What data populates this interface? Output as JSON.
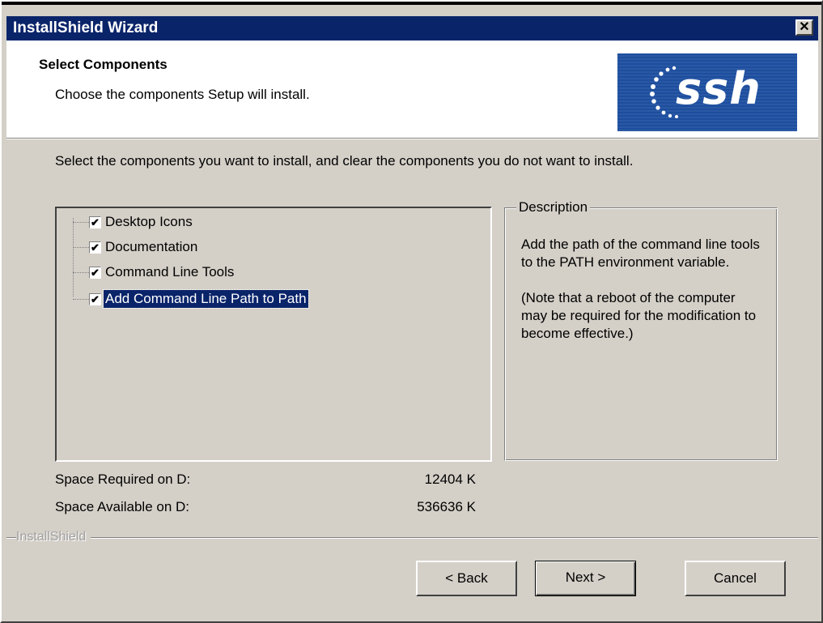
{
  "window": {
    "title": "InstallShield Wizard",
    "close_glyph": "✕"
  },
  "header": {
    "title": "Select Components",
    "subtitle": "Choose the components Setup will install.",
    "logo_text": "ssh"
  },
  "instructions": "Select the components you want to install, and clear the components you do not want to install.",
  "components": [
    {
      "label": "Desktop Icons",
      "checked": true,
      "selected": false
    },
    {
      "label": "Documentation",
      "checked": true,
      "selected": false
    },
    {
      "label": "Command Line Tools",
      "checked": true,
      "selected": false
    },
    {
      "label": "Add Command Line Path to Path",
      "checked": true,
      "selected": true
    }
  ],
  "check_glyph": "✔",
  "description": {
    "legend": "Description",
    "paragraph1": "Add the path of the command line tools to the PATH environment variable.",
    "paragraph2": "(Note that a reboot of the computer may be required for the modification to become effective.)"
  },
  "space": {
    "required_label": "Space Required on  D:",
    "required_value": "12404 K",
    "available_label": "Space Available on  D:",
    "available_value": "536636 K"
  },
  "brand": "InstallShield",
  "buttons": {
    "back": "< Back",
    "next": "Next >",
    "cancel": "Cancel"
  },
  "colors": {
    "titlebar": "#0a246a",
    "face": "#d4d0c8",
    "logo_bg": "#1d4e9e",
    "selection": "#0a246a"
  }
}
